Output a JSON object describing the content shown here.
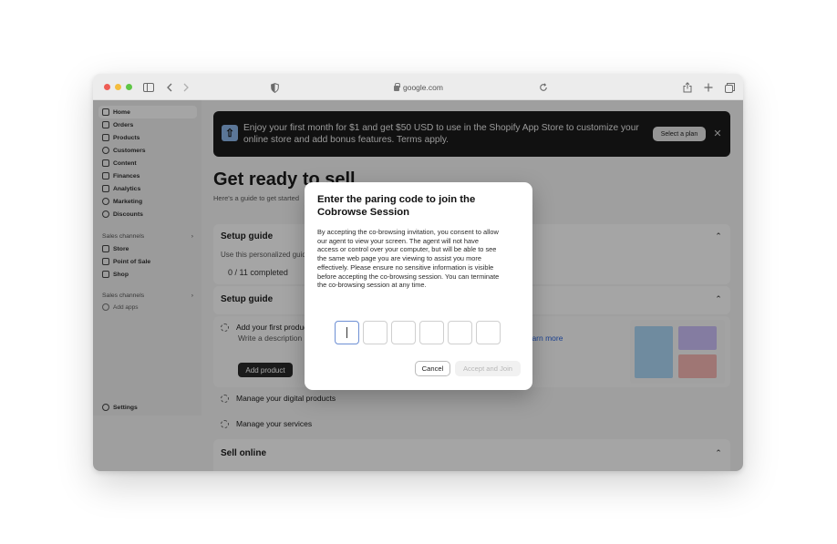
{
  "browser": {
    "url": "google.com",
    "icons": {
      "sidebar": "sidebar-toggle-icon",
      "back": "chevron-left-icon",
      "forward": "chevron-right-icon",
      "shield": "shield-icon",
      "reload": "reload-icon",
      "share": "share-icon",
      "new_tab": "plus-icon",
      "tabs": "tabs-overview-icon"
    }
  },
  "sidebar": {
    "items": [
      {
        "label": "Home",
        "icon": "home-icon"
      },
      {
        "label": "Orders",
        "icon": "orders-icon"
      },
      {
        "label": "Products",
        "icon": "tag-icon"
      },
      {
        "label": "Customers",
        "icon": "person-icon"
      },
      {
        "label": "Content",
        "icon": "content-icon"
      },
      {
        "label": "Finances",
        "icon": "bank-icon"
      },
      {
        "label": "Analytics",
        "icon": "bar-chart-icon"
      },
      {
        "label": "Marketing",
        "icon": "target-icon"
      },
      {
        "label": "Discounts",
        "icon": "discount-icon"
      }
    ],
    "sales_channels": {
      "label": "Sales channels",
      "items": [
        {
          "label": "Store",
          "icon": "store-icon"
        },
        {
          "label": "Point of Sale",
          "icon": "pos-icon"
        },
        {
          "label": "Shop",
          "icon": "shopping-bag-icon"
        }
      ]
    },
    "apps_section": {
      "label": "Sales channels",
      "add_apps": "Add apps"
    },
    "settings": "Settings"
  },
  "banner": {
    "text": "Enjoy your first month for $1 and get $50 USD to use in the Shopify App Store to customize your online store and add bonus features. Terms apply.",
    "button": "Select a plan"
  },
  "page": {
    "title": "Get ready to sell",
    "subtitle": "Here's a guide to get started"
  },
  "setup_guide_1": {
    "title": "Setup guide",
    "description": "Use this personalized guide",
    "progress": "0 / 11 completed"
  },
  "setup_guide_2": {
    "title": "Setup guide",
    "task_first": "Add your first product",
    "task_first_desc": "Write a description",
    "learn_more": "Learn more",
    "add_product": "Add product",
    "task_digital": "Manage your digital products",
    "task_services": "Manage your services"
  },
  "sell_online": {
    "title": "Sell online"
  },
  "modal": {
    "title": "Enter the paring code to join the Cobrowse Session",
    "body": "By accepting the co-browsing invitation, you consent to allow our agent to view your screen. The agent will not have access or control over your computer, but will be able to see the same web page you are viewing to assist you more effectively.  Please ensure no sensitive information is visible before accepting the co-browsing session. You can terminate the co-browsing session at any time.",
    "code_digits": [
      "",
      "",
      "",
      "",
      "",
      ""
    ],
    "cancel": "Cancel",
    "accept": "Accept and Join"
  },
  "colors": {
    "banner_bg": "#1a1a1a",
    "overlay": "rgba(0,0,0,0.34)",
    "focus_border": "#6d8fd4",
    "link": "#2b63d9"
  }
}
